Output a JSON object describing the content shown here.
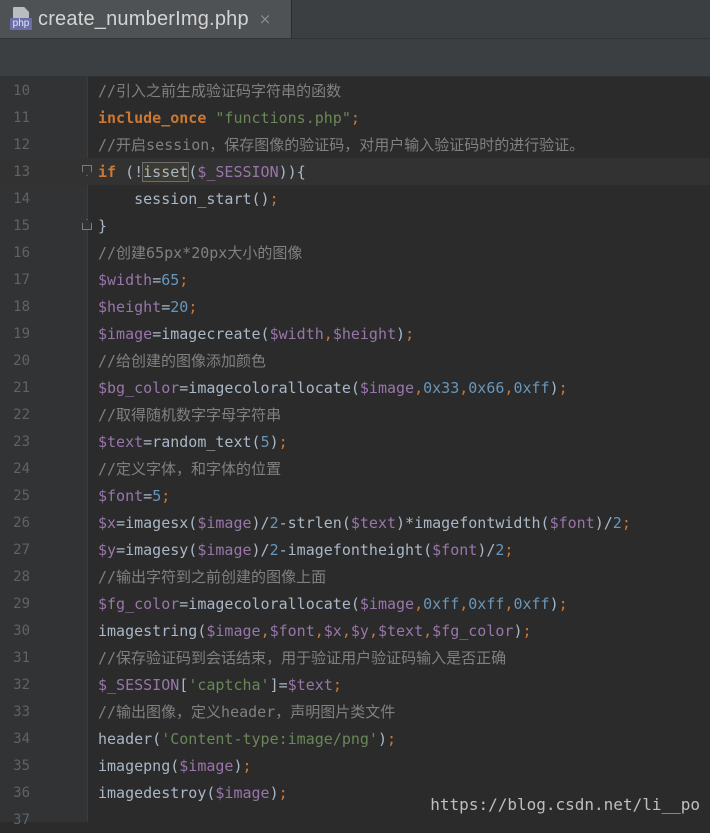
{
  "tab": {
    "icon": "php-file-icon",
    "icon_label": "php",
    "title": "create_numberImg.php",
    "close": "×"
  },
  "code_lines": [
    {
      "n": "10",
      "t": [
        [
          "cm",
          "//引入之前生成验证码字符串的函数"
        ]
      ]
    },
    {
      "n": "11",
      "t": [
        [
          "kw",
          "include_once"
        ],
        [
          "fn",
          " "
        ],
        [
          "st",
          "\"functions.php\""
        ],
        [
          "op",
          ";"
        ]
      ]
    },
    {
      "n": "12",
      "t": [
        [
          "cm",
          "//开启session，保存图像的验证码，对用户输入验证码时的进行验证。"
        ]
      ]
    },
    {
      "n": "13",
      "t": [
        [
          "kw",
          "if"
        ],
        [
          "fn",
          " (!"
        ],
        [
          "fn",
          "isset"
        ],
        [
          "fn",
          "("
        ],
        [
          "vr",
          "$_SESSION"
        ],
        [
          "fn",
          "))"
        ],
        [
          "fn",
          "{"
        ]
      ]
    },
    {
      "n": "14",
      "t": [
        [
          "fn",
          "    session_start()"
        ],
        [
          "op",
          ";"
        ]
      ]
    },
    {
      "n": "15",
      "t": [
        [
          "fn",
          "}"
        ]
      ]
    },
    {
      "n": "16",
      "t": [
        [
          "cm",
          "//创建65px*20px大小的图像"
        ]
      ]
    },
    {
      "n": "17",
      "t": [
        [
          "vr",
          "$width"
        ],
        [
          "fn",
          "="
        ],
        [
          "nu",
          "65"
        ],
        [
          "op",
          ";"
        ]
      ]
    },
    {
      "n": "18",
      "t": [
        [
          "vr",
          "$height"
        ],
        [
          "fn",
          "="
        ],
        [
          "nu",
          "20"
        ],
        [
          "op",
          ";"
        ]
      ]
    },
    {
      "n": "19",
      "t": [
        [
          "vr",
          "$image"
        ],
        [
          "fn",
          "=imagecreate("
        ],
        [
          "vr",
          "$width"
        ],
        [
          "op",
          ","
        ],
        [
          "vr",
          "$height"
        ],
        [
          "fn",
          ")"
        ],
        [
          "op",
          ";"
        ]
      ]
    },
    {
      "n": "20",
      "t": [
        [
          "cm",
          "//给创建的图像添加颜色"
        ]
      ]
    },
    {
      "n": "21",
      "t": [
        [
          "vr",
          "$bg_color"
        ],
        [
          "fn",
          "=imagecolorallocate("
        ],
        [
          "vr",
          "$image"
        ],
        [
          "op",
          ","
        ],
        [
          "nu",
          "0x33"
        ],
        [
          "op",
          ","
        ],
        [
          "nu",
          "0x66"
        ],
        [
          "op",
          ","
        ],
        [
          "nu",
          "0xff"
        ],
        [
          "fn",
          ")"
        ],
        [
          "op",
          ";"
        ]
      ]
    },
    {
      "n": "22",
      "t": [
        [
          "cm",
          "//取得随机数字字母字符串"
        ]
      ]
    },
    {
      "n": "23",
      "t": [
        [
          "vr",
          "$text"
        ],
        [
          "fn",
          "=random_text("
        ],
        [
          "nu",
          "5"
        ],
        [
          "fn",
          ")"
        ],
        [
          "op",
          ";"
        ]
      ]
    },
    {
      "n": "24",
      "t": [
        [
          "cm",
          "//定义字体，和字体的位置"
        ]
      ]
    },
    {
      "n": "25",
      "t": [
        [
          "vr",
          "$font"
        ],
        [
          "fn",
          "="
        ],
        [
          "nu",
          "5"
        ],
        [
          "op",
          ";"
        ]
      ]
    },
    {
      "n": "26",
      "t": [
        [
          "vr",
          "$x"
        ],
        [
          "fn",
          "=imagesx("
        ],
        [
          "vr",
          "$image"
        ],
        [
          "fn",
          ")/"
        ],
        [
          "nu",
          "2"
        ],
        [
          "fn",
          "-strlen("
        ],
        [
          "vr",
          "$text"
        ],
        [
          "fn",
          ")*imagefontwidth("
        ],
        [
          "vr",
          "$font"
        ],
        [
          "fn",
          ")/"
        ],
        [
          "nu",
          "2"
        ],
        [
          "op",
          ";"
        ]
      ]
    },
    {
      "n": "27",
      "t": [
        [
          "vr",
          "$y"
        ],
        [
          "fn",
          "=imagesy("
        ],
        [
          "vr",
          "$image"
        ],
        [
          "fn",
          ")/"
        ],
        [
          "nu",
          "2"
        ],
        [
          "fn",
          "-imagefontheight("
        ],
        [
          "vr",
          "$font"
        ],
        [
          "fn",
          ")/"
        ],
        [
          "nu",
          "2"
        ],
        [
          "op",
          ";"
        ]
      ]
    },
    {
      "n": "28",
      "t": [
        [
          "cm",
          "//输出字符到之前创建的图像上面"
        ]
      ]
    },
    {
      "n": "29",
      "t": [
        [
          "vr",
          "$fg_color"
        ],
        [
          "fn",
          "=imagecolorallocate("
        ],
        [
          "vr",
          "$image"
        ],
        [
          "op",
          ","
        ],
        [
          "nu",
          "0xff"
        ],
        [
          "op",
          ","
        ],
        [
          "nu",
          "0xff"
        ],
        [
          "op",
          ","
        ],
        [
          "nu",
          "0xff"
        ],
        [
          "fn",
          ")"
        ],
        [
          "op",
          ";"
        ]
      ]
    },
    {
      "n": "30",
      "t": [
        [
          "fn",
          "imagestring("
        ],
        [
          "vr",
          "$image"
        ],
        [
          "op",
          ","
        ],
        [
          "vr",
          "$font"
        ],
        [
          "op",
          ","
        ],
        [
          "vr",
          "$x"
        ],
        [
          "op",
          ","
        ],
        [
          "vr",
          "$y"
        ],
        [
          "op",
          ","
        ],
        [
          "vr",
          "$text"
        ],
        [
          "op",
          ","
        ],
        [
          "vr",
          "$fg_color"
        ],
        [
          "fn",
          ")"
        ],
        [
          "op",
          ";"
        ]
      ]
    },
    {
      "n": "31",
      "t": [
        [
          "cm",
          "//保存验证码到会话结束，用于验证用户验证码输入是否正确"
        ]
      ]
    },
    {
      "n": "32",
      "t": [
        [
          "vr",
          "$_SESSION"
        ],
        [
          "fn",
          "["
        ],
        [
          "st",
          "'captcha'"
        ],
        [
          "fn",
          "]="
        ],
        [
          "vr",
          "$text"
        ],
        [
          "op",
          ";"
        ]
      ]
    },
    {
      "n": "33",
      "t": [
        [
          "cm",
          "//输出图像，定义header，声明图片类文件"
        ]
      ]
    },
    {
      "n": "34",
      "t": [
        [
          "fn",
          "header("
        ],
        [
          "st",
          "'Content-type:image/png'"
        ],
        [
          "fn",
          ")"
        ],
        [
          "op",
          ";"
        ]
      ]
    },
    {
      "n": "35",
      "t": [
        [
          "fn",
          "imagepng("
        ],
        [
          "vr",
          "$image"
        ],
        [
          "fn",
          ")"
        ],
        [
          "op",
          ";"
        ]
      ]
    },
    {
      "n": "36",
      "t": [
        [
          "fn",
          "imagedestroy("
        ],
        [
          "vr",
          "$image"
        ],
        [
          "fn",
          ")"
        ],
        [
          "op",
          ";"
        ]
      ]
    },
    {
      "n": "37",
      "t": []
    }
  ],
  "highlight_line": "13",
  "watermark": "https://blog.csdn.net/li__po"
}
